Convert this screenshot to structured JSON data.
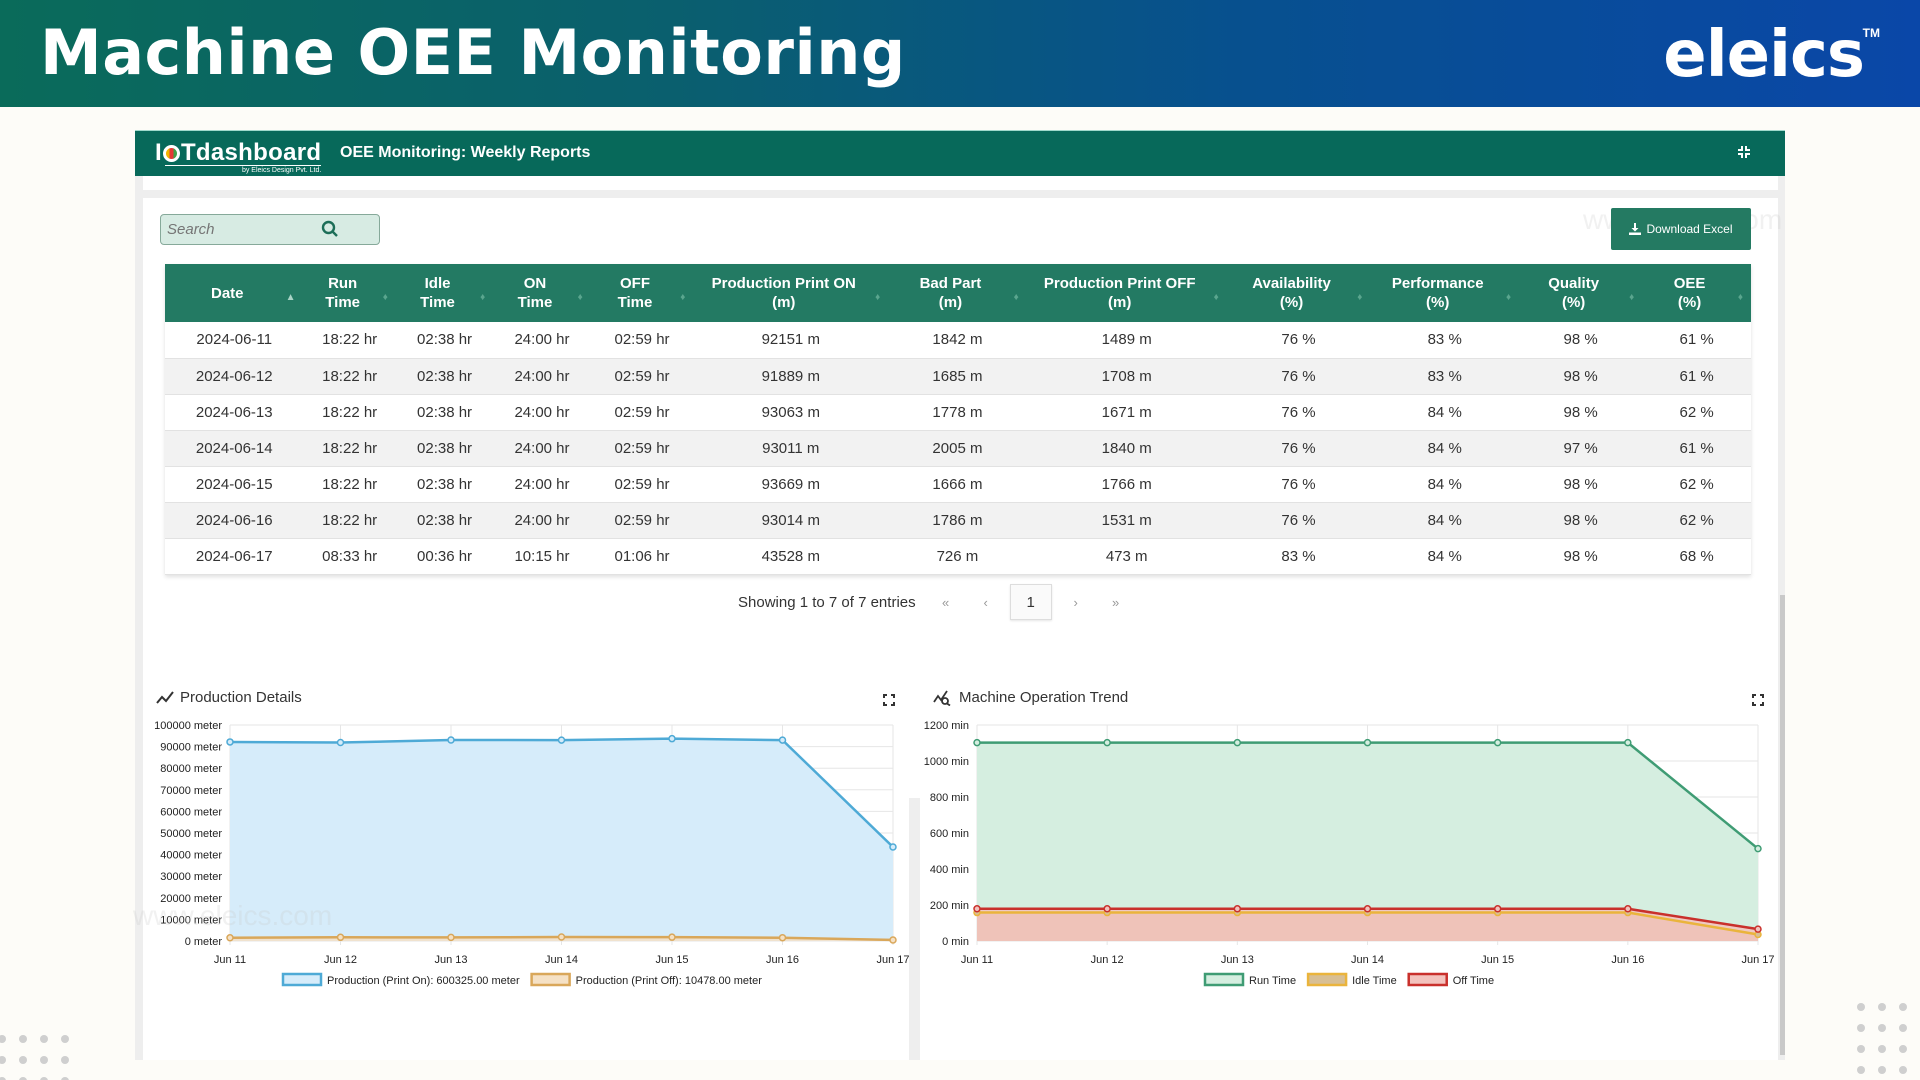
{
  "banner": {
    "title": "Machine OEE Monitoring",
    "brand": "eleics",
    "trademark": "TM"
  },
  "app": {
    "logo_main": "IOTdashboard",
    "logo_sub": "by Eleics Design Pvt. Ltd.",
    "title": "OEE Monitoring: Weekly Reports"
  },
  "search": {
    "placeholder": "Search",
    "value": ""
  },
  "download_label": "Download Excel",
  "watermark": "www.eleics.com",
  "table": {
    "columns": [
      {
        "l1": "Date",
        "l2": ""
      },
      {
        "l1": "Run",
        "l2": "Time"
      },
      {
        "l1": "Idle",
        "l2": "Time"
      },
      {
        "l1": "ON",
        "l2": "Time"
      },
      {
        "l1": "OFF",
        "l2": "Time"
      },
      {
        "l1": "Production Print ON",
        "l2": "(m)"
      },
      {
        "l1": "Bad Part",
        "l2": "(m)"
      },
      {
        "l1": "Production Print OFF",
        "l2": "(m)"
      },
      {
        "l1": "Availability",
        "l2": "(%)"
      },
      {
        "l1": "Performance",
        "l2": "(%)"
      },
      {
        "l1": "Quality",
        "l2": "(%)"
      },
      {
        "l1": "OEE",
        "l2": "(%)"
      }
    ],
    "sorted_column": 0,
    "rows": [
      [
        "2024-06-11",
        "18:22 hr",
        "02:38 hr",
        "24:00 hr",
        "02:59 hr",
        "92151 m",
        "1842 m",
        "1489 m",
        "76 %",
        "83 %",
        "98 %",
        "61 %"
      ],
      [
        "2024-06-12",
        "18:22 hr",
        "02:38 hr",
        "24:00 hr",
        "02:59 hr",
        "91889 m",
        "1685 m",
        "1708 m",
        "76 %",
        "83 %",
        "98 %",
        "61 %"
      ],
      [
        "2024-06-13",
        "18:22 hr",
        "02:38 hr",
        "24:00 hr",
        "02:59 hr",
        "93063 m",
        "1778 m",
        "1671 m",
        "76 %",
        "84 %",
        "98 %",
        "62 %"
      ],
      [
        "2024-06-14",
        "18:22 hr",
        "02:38 hr",
        "24:00 hr",
        "02:59 hr",
        "93011 m",
        "2005 m",
        "1840 m",
        "76 %",
        "84 %",
        "97 %",
        "61 %"
      ],
      [
        "2024-06-15",
        "18:22 hr",
        "02:38 hr",
        "24:00 hr",
        "02:59 hr",
        "93669 m",
        "1666 m",
        "1766 m",
        "76 %",
        "84 %",
        "98 %",
        "62 %"
      ],
      [
        "2024-06-16",
        "18:22 hr",
        "02:38 hr",
        "24:00 hr",
        "02:59 hr",
        "93014 m",
        "1786 m",
        "1531 m",
        "76 %",
        "84 %",
        "98 %",
        "62 %"
      ],
      [
        "2024-06-17",
        "08:33 hr",
        "00:36 hr",
        "10:15 hr",
        "01:06 hr",
        "43528 m",
        "726 m",
        "473 m",
        "83 %",
        "84 %",
        "98 %",
        "68 %"
      ]
    ]
  },
  "pagination": {
    "info": "Showing 1 to 7 of 7 entries",
    "first": "«",
    "prev": "‹",
    "current": "1",
    "next": "›",
    "last": "»"
  },
  "chart_data": [
    {
      "type": "area",
      "title": "Production Details",
      "categories": [
        "Jun 11",
        "Jun 12",
        "Jun 13",
        "Jun 14",
        "Jun 15",
        "Jun 16",
        "Jun 17"
      ],
      "ylim": [
        0,
        100000
      ],
      "yticks": [
        0,
        10000,
        20000,
        30000,
        40000,
        50000,
        60000,
        70000,
        80000,
        90000,
        100000
      ],
      "yunit": "meter",
      "grid": true,
      "legend": "bottom",
      "series": [
        {
          "name": "Production (Print On): 600325.00 meter",
          "color": "#4eaad6",
          "fill": "#d6ecfa",
          "values": [
            92151,
            91889,
            93063,
            93011,
            93669,
            93014,
            43528
          ]
        },
        {
          "name": "Production (Print Off): 10478.00 meter",
          "color": "#d9a75a",
          "fill": "#f5e1c5",
          "values": [
            1489,
            1708,
            1671,
            1840,
            1766,
            1531,
            473
          ]
        }
      ]
    },
    {
      "type": "area",
      "title": "Machine Operation Trend",
      "categories": [
        "Jun 11",
        "Jun 12",
        "Jun 13",
        "Jun 14",
        "Jun 15",
        "Jun 16",
        "Jun 17"
      ],
      "ylim": [
        0,
        1200
      ],
      "yticks": [
        0,
        200,
        400,
        600,
        800,
        1000,
        1200
      ],
      "yunit": "min",
      "grid": true,
      "legend": "bottom",
      "series": [
        {
          "name": "Run Time",
          "color": "#3f9c74",
          "fill": "#d5eee0",
          "values": [
            1102,
            1102,
            1102,
            1102,
            1102,
            1102,
            513
          ]
        },
        {
          "name": "Idle Time",
          "color": "#eab43c",
          "fill": "#d8bf94",
          "values": [
            158,
            158,
            158,
            158,
            158,
            158,
            36
          ]
        },
        {
          "name": "Off Time",
          "color": "#c9302c",
          "fill": "#f3c2bd",
          "values": [
            179,
            179,
            179,
            179,
            179,
            179,
            66
          ]
        }
      ]
    }
  ]
}
